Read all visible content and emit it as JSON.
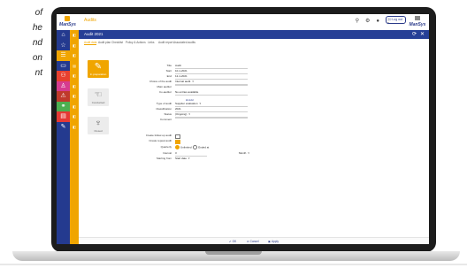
{
  "page_text_fragments": [
    "of",
    "he",
    "nd",
    "on",
    "nt"
  ],
  "app": {
    "brand": "ManSys",
    "title": "Audits",
    "top_icons": [
      {
        "name": "search-icon",
        "glyph": "⚲"
      },
      {
        "name": "settings-icon",
        "glyph": "⚙"
      },
      {
        "name": "user-icon",
        "glyph": "●"
      },
      {
        "name": "more-icon",
        "glyph": "⋮"
      }
    ],
    "logout_label": "⏻ Log out",
    "brand_right": "ManSys"
  },
  "rail": {
    "icons": [
      {
        "name": "home-icon",
        "glyph": "⌂"
      },
      {
        "name": "star-icon",
        "glyph": "☆"
      },
      {
        "name": "list-icon",
        "glyph": "☰"
      },
      {
        "name": "monitor-icon",
        "glyph": "▭"
      },
      {
        "name": "people-icon",
        "glyph": "⚇"
      },
      {
        "name": "person-icon",
        "glyph": "♙"
      },
      {
        "name": "warning-icon",
        "glyph": "⚠"
      },
      {
        "name": "handshake-icon",
        "glyph": "⚭"
      },
      {
        "name": "document-icon",
        "glyph": "▤"
      },
      {
        "name": "wrench-icon",
        "glyph": "✎"
      }
    ],
    "sub_glyphs": [
      "◧",
      "◧",
      "◧",
      "▤",
      "◧",
      "◧",
      "◧",
      "◧",
      "◧",
      "◧"
    ]
  },
  "form": {
    "title": "Audit 2021",
    "tabs": [
      {
        "label": "Audit data",
        "active": true
      },
      {
        "label": "Audit plan",
        "active": false
      },
      {
        "label": "Checklist",
        "active": false
      },
      {
        "label": "Policy & Actions",
        "active": false
      },
      {
        "label": "Links",
        "active": false
      },
      {
        "label": "Audit report",
        "active": false
      },
      {
        "label": "Associated audits",
        "active": false
      }
    ],
    "workflow": [
      {
        "label": "In preparation",
        "glyph": "✎",
        "active": true
      },
      {
        "label": "Conducted",
        "glyph": "☜",
        "active": false
      },
      {
        "label": "Closed",
        "glyph": "♆",
        "active": false
      }
    ],
    "fields": [
      {
        "label": "Title",
        "value": "Audit",
        "kind": "text"
      },
      {
        "label": "Start",
        "value": "10-1-2021",
        "kind": "text"
      },
      {
        "label": "End",
        "value": "12-1-2021",
        "kind": "text"
      },
      {
        "label": "Choice of the audit",
        "value": "Internal audit",
        "kind": "select"
      },
      {
        "label": "Main auditor",
        "value": "",
        "kind": "text"
      },
      {
        "label": "Co-auditor",
        "value": "No entries available",
        "kind": "text"
      },
      {
        "label": "",
        "value": "",
        "kind": "spacer"
      },
      {
        "label": "Type of audit",
        "value": "Supplier evaluation",
        "kind": "select"
      },
      {
        "label": "Classification",
        "value": "2021",
        "kind": "text"
      },
      {
        "label": "Status",
        "value": "(Ongoing)",
        "kind": "select"
      },
      {
        "label": "Comment",
        "value": "",
        "kind": "text"
      }
    ],
    "add_label": "⊕ Add",
    "create_follow_up": {
      "label": "Create follow-up audit",
      "checked": false
    },
    "create_repeat": {
      "label": "Create repeat audit",
      "checked": true
    },
    "quarterly": {
      "label": "Quarterly",
      "options": [
        "Unlimited",
        "Ended at"
      ],
      "selected": 0
    },
    "interval": {
      "label": "Interval",
      "value": "3",
      "unit": "Month"
    },
    "starting_from": {
      "label": "Starting from",
      "value": "Start date"
    }
  },
  "footer": {
    "ok": "OK",
    "cancel": "Cancel",
    "apply": "Apply"
  }
}
